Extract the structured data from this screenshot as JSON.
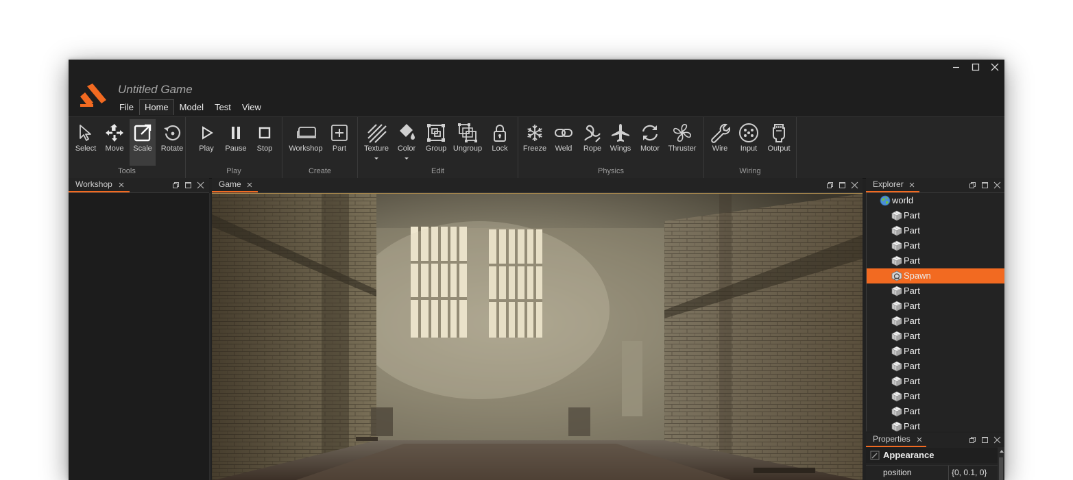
{
  "app": {
    "title": "Untitled Game"
  },
  "menu": [
    {
      "label": "File",
      "active": false
    },
    {
      "label": "Home",
      "active": true
    },
    {
      "label": "Model",
      "active": false
    },
    {
      "label": "Test",
      "active": false
    },
    {
      "label": "View",
      "active": false
    }
  ],
  "ribbon": {
    "groups": [
      {
        "label": "Tools",
        "tools": [
          {
            "label": "Select",
            "icon": "cursor-icon"
          },
          {
            "label": "Move",
            "icon": "move-arrows-icon"
          },
          {
            "label": "Scale",
            "icon": "scale-icon",
            "selected": true
          },
          {
            "label": "Rotate",
            "icon": "rotate-icon"
          }
        ]
      },
      {
        "label": "Play",
        "tools": [
          {
            "label": "Play",
            "icon": "play-icon"
          },
          {
            "label": "Pause",
            "icon": "pause-icon"
          },
          {
            "label": "Stop",
            "icon": "stop-icon"
          }
        ]
      },
      {
        "label": "Create",
        "tools": [
          {
            "label": "Workshop",
            "icon": "sofa-icon"
          },
          {
            "label": "Part",
            "icon": "plus-box-icon"
          }
        ]
      },
      {
        "label": "Edit",
        "tools": [
          {
            "label": "Texture",
            "icon": "texture-icon",
            "dropdown": true
          },
          {
            "label": "Color",
            "icon": "paint-bucket-icon",
            "dropdown": true
          },
          {
            "label": "Group",
            "icon": "group-icon"
          },
          {
            "label": "Ungroup",
            "icon": "ungroup-icon"
          },
          {
            "label": "Lock",
            "icon": "lock-icon"
          }
        ]
      },
      {
        "label": "Physics",
        "tools": [
          {
            "label": "Freeze",
            "icon": "snowflake-icon"
          },
          {
            "label": "Weld",
            "icon": "link-icon"
          },
          {
            "label": "Rope",
            "icon": "rope-icon"
          },
          {
            "label": "Wings",
            "icon": "airplane-icon"
          },
          {
            "label": "Motor",
            "icon": "refresh-icon"
          },
          {
            "label": "Thruster",
            "icon": "fan-icon"
          }
        ]
      },
      {
        "label": "Wiring",
        "tools": [
          {
            "label": "Wire",
            "icon": "wrench-icon"
          },
          {
            "label": "Input",
            "icon": "connector-icon"
          },
          {
            "label": "Output",
            "icon": "plug-icon"
          }
        ]
      }
    ]
  },
  "panels": {
    "workshop": {
      "title": "Workshop"
    },
    "game": {
      "title": "Game"
    },
    "explorer": {
      "title": "Explorer"
    },
    "properties": {
      "title": "Properties"
    }
  },
  "explorer": {
    "items": [
      {
        "label": "world",
        "icon": "globe-icon",
        "level": 0
      },
      {
        "label": "Part",
        "icon": "cube-icon",
        "level": 1
      },
      {
        "label": "Part",
        "icon": "cube-icon",
        "level": 1
      },
      {
        "label": "Part",
        "icon": "cube-icon",
        "level": 1
      },
      {
        "label": "Part",
        "icon": "cube-icon",
        "level": 1
      },
      {
        "label": "Spawn",
        "icon": "spawn-icon",
        "level": 1,
        "selected": true
      },
      {
        "label": "Part",
        "icon": "cube-icon",
        "level": 1
      },
      {
        "label": "Part",
        "icon": "cube-icon",
        "level": 1
      },
      {
        "label": "Part",
        "icon": "cube-icon",
        "level": 1
      },
      {
        "label": "Part",
        "icon": "cube-icon",
        "level": 1
      },
      {
        "label": "Part",
        "icon": "cube-icon",
        "level": 1
      },
      {
        "label": "Part",
        "icon": "cube-icon",
        "level": 1
      },
      {
        "label": "Part",
        "icon": "cube-icon",
        "level": 1
      },
      {
        "label": "Part",
        "icon": "cube-icon",
        "level": 1
      },
      {
        "label": "Part",
        "icon": "cube-icon",
        "level": 1
      },
      {
        "label": "Part",
        "icon": "cube-icon",
        "level": 1
      }
    ]
  },
  "properties": {
    "section": "Appearance",
    "rows": [
      {
        "name": "position",
        "value": "{0, 0.1, 0}"
      }
    ]
  },
  "colors": {
    "accent": "#f26a21",
    "background": "#212121",
    "ribbon": "#262626",
    "text": "#cfcfcf"
  }
}
